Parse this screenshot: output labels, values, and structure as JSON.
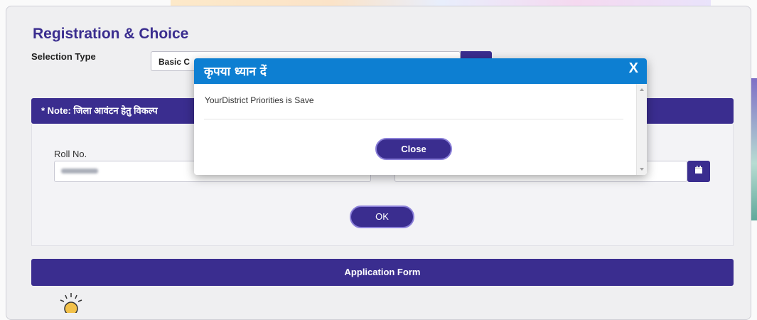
{
  "page": {
    "title": "Registration & Choice",
    "selection_type_label": "Selection Type",
    "selection_type_value": "Basic C",
    "note_text": "* Note: जिला आवंटन हेतु विकल्प",
    "roll_label": "Roll No.",
    "ok_label": "OK",
    "application_form_label": "Application Form"
  },
  "modal": {
    "title": "कृपया ध्यान दें",
    "close_x": "X",
    "message": "YourDistrict Priorities is Save",
    "close_button": "Close"
  },
  "icons": {
    "select_dropdown": "chevron-down-icon",
    "calendar": "calendar-icon",
    "bulb": "bulb-icon"
  },
  "colors": {
    "primary": "#3a2d8f",
    "modal_header": "#0d7fd2"
  }
}
